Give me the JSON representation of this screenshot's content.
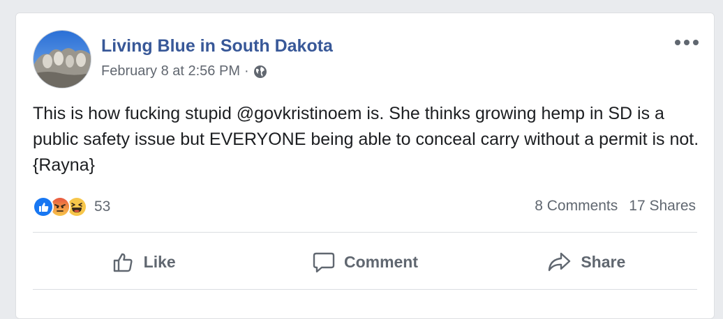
{
  "post": {
    "page_name": "Living Blue in South Dakota",
    "timestamp": "February 8 at 2:56 PM",
    "separator": "·",
    "privacy_icon": "globe-icon",
    "text": "This is how fucking stupid @govkristinoem is. She thinks growing hemp in SD is a public safety issue but EVERYONE being able to conceal carry without a permit is not. {Rayna}"
  },
  "reactions": {
    "types": [
      "like-reaction-icon",
      "angry-reaction-icon",
      "haha-reaction-icon"
    ],
    "count": "53"
  },
  "stats": {
    "comments": "8 Comments",
    "shares": "17 Shares"
  },
  "actions": {
    "like": "Like",
    "comment": "Comment",
    "share": "Share"
  },
  "colors": {
    "link": "#385898",
    "secondary": "#606770",
    "like_blue": "#1877f2",
    "reaction_yellow": "#f7c64a"
  }
}
